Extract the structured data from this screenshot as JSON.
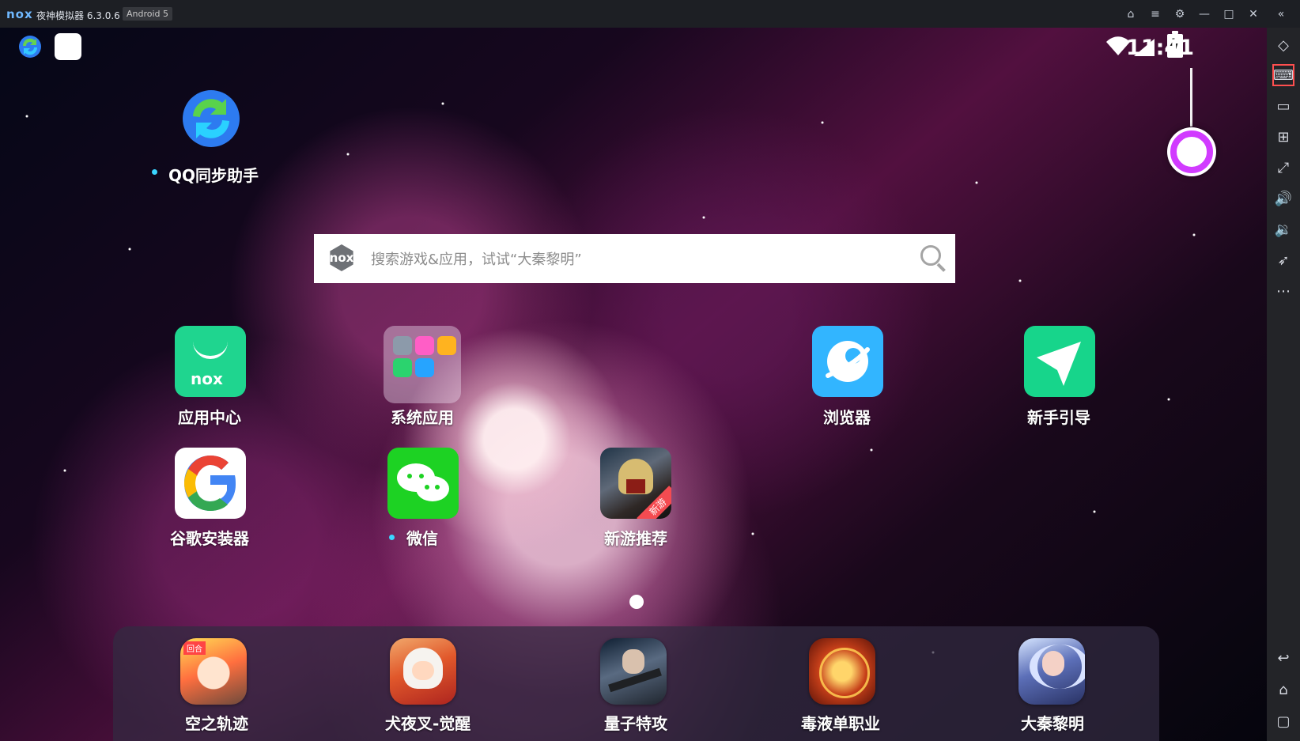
{
  "window": {
    "logo": "nox",
    "title": "夜神模拟器 6.3.0.6",
    "android_badge": "Android 5"
  },
  "status": {
    "time": "11:41"
  },
  "desktop": {
    "top_app_label": "QQ同步助手",
    "search_placeholder": "搜索游戏&应用，试试“大秦黎明”",
    "apps_row1": [
      "应用中心",
      "系统应用",
      "浏览器",
      "新手引导"
    ],
    "apps_row2": [
      "谷歌安装器",
      "微信",
      "新游推荐"
    ],
    "new_badge": "新游"
  },
  "dock": {
    "items": [
      "空之轨迹",
      "犬夜叉-觉醒",
      "量子特攻",
      "毒液单职业",
      "大秦黎明"
    ]
  }
}
